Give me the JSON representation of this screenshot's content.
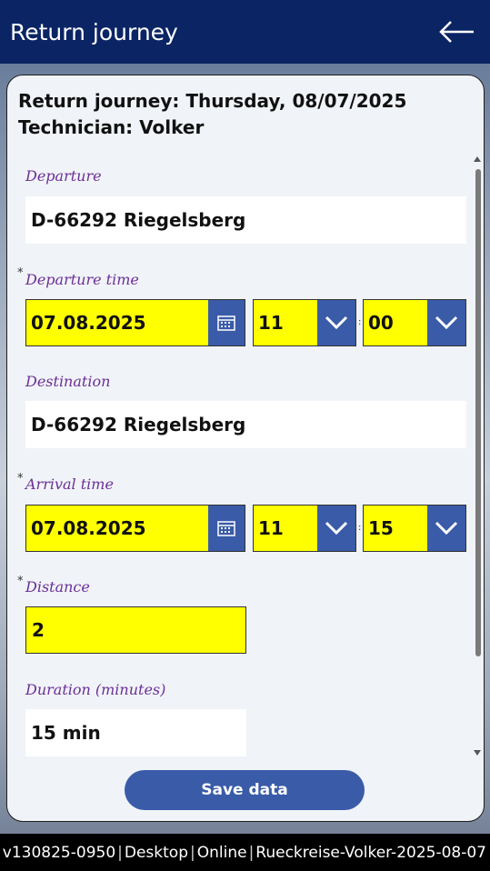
{
  "header": {
    "title": "Return journey",
    "back_icon": "arrow-left-icon"
  },
  "card": {
    "heading_line1": "Return journey: Thursday, 08/07/2025",
    "heading_line2": "Technician: Volker"
  },
  "form": {
    "departure": {
      "label": "Departure",
      "value": "D-66292 Riegelsberg"
    },
    "departure_time": {
      "label": "Departure time",
      "required": "*",
      "date": "07.08.2025",
      "hour": "11",
      "minute": "00",
      "separator": ":"
    },
    "destination": {
      "label": "Destination",
      "value": "D-66292 Riegelsberg"
    },
    "arrival_time": {
      "label": "Arrival time",
      "required": "*",
      "date": "07.08.2025",
      "hour": "11",
      "minute": "15",
      "separator": ":"
    },
    "distance": {
      "label": "Distance",
      "required": "*",
      "value": "2"
    },
    "duration": {
      "label": "Duration (minutes)",
      "value": "15 min"
    }
  },
  "save_button": {
    "label": "Save data"
  },
  "footer": {
    "version": "v130825-0950",
    "device": "Desktop",
    "status": "Online",
    "record": "Rueckreise-Volker-2025-08-07",
    "separator": "|"
  },
  "colors": {
    "header_bg": "#0b2464",
    "accent": "#3a5ba8",
    "highlight": "#ffff00",
    "label": "#6b2f96"
  }
}
